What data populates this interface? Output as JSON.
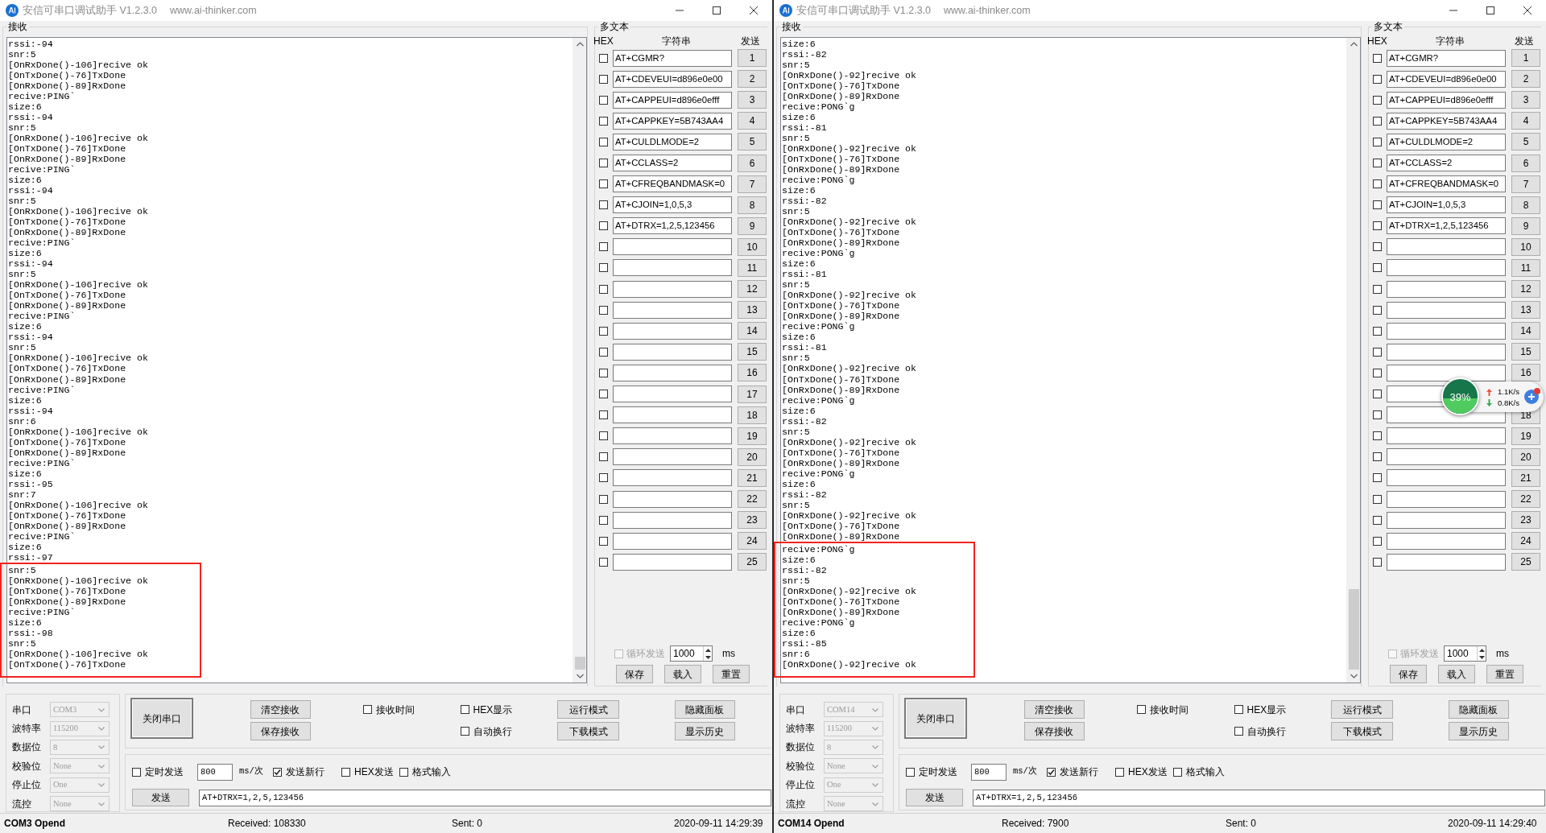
{
  "windows": [
    {
      "title": "安信可串口调试助手 V1.2.3.0",
      "website": "www.ai-thinker.com",
      "receive": {
        "label": "接收",
        "lines": [
          "rssi:-94",
          "snr:5",
          "[OnRxDone()-106]recive ok",
          "[OnTxDone()-76]TxDone",
          "[OnRxDone()-89]RxDone",
          "recive:PING`",
          "size:6",
          "rssi:-94",
          "snr:5",
          "[OnRxDone()-106]recive ok",
          "[OnTxDone()-76]TxDone",
          "[OnRxDone()-89]RxDone",
          "recive:PING`",
          "size:6",
          "rssi:-94",
          "snr:5",
          "[OnRxDone()-106]recive ok",
          "[OnTxDone()-76]TxDone",
          "[OnRxDone()-89]RxDone",
          "recive:PING`",
          "size:6",
          "rssi:-94",
          "snr:5",
          "[OnRxDone()-106]recive ok",
          "[OnTxDone()-76]TxDone",
          "[OnRxDone()-89]RxDone",
          "recive:PING`",
          "size:6",
          "rssi:-94",
          "snr:5",
          "[OnRxDone()-106]recive ok",
          "[OnTxDone()-76]TxDone",
          "[OnRxDone()-89]RxDone",
          "recive:PING`",
          "size:6",
          "rssi:-94",
          "snr:6",
          "[OnRxDone()-106]recive ok",
          "[OnTxDone()-76]TxDone",
          "[OnRxDone()-89]RxDone",
          "recive:PING`",
          "size:6",
          "rssi:-95",
          "snr:7",
          "[OnRxDone()-106]recive ok",
          "[OnTxDone()-76]TxDone",
          "[OnRxDone()-89]RxDone",
          "recive:PING`",
          "size:6",
          "rssi:-97"
        ],
        "highlighted_lines": [
          "snr:5",
          "[OnRxDone()-106]recive ok",
          "[OnTxDone()-76]TxDone",
          "[OnRxDone()-89]RxDone",
          "recive:PING`",
          "size:6",
          "rssi:-98",
          "snr:5",
          "[OnRxDone()-106]recive ok",
          "[OnTxDone()-76]TxDone"
        ]
      },
      "multi_text": {
        "label": "多文本",
        "columns": [
          "HEX",
          "字符串",
          "发送"
        ],
        "rows": [
          {
            "hex": false,
            "text": "AT+CGMR?",
            "button": "1"
          },
          {
            "hex": false,
            "text": "AT+CDEVEUI=d896e0e00",
            "button": "2"
          },
          {
            "hex": false,
            "text": "AT+CAPPEUI=d896e0efff",
            "button": "3"
          },
          {
            "hex": false,
            "text": "AT+CAPPKEY=5B743AA4",
            "button": "4"
          },
          {
            "hex": false,
            "text": "AT+CULDLMODE=2",
            "button": "5"
          },
          {
            "hex": false,
            "text": "AT+CCLASS=2",
            "button": "6"
          },
          {
            "hex": false,
            "text": "AT+CFREQBANDMASK=0",
            "button": "7"
          },
          {
            "hex": false,
            "text": "AT+CJOIN=1,0,5,3",
            "button": "8"
          },
          {
            "hex": false,
            "text": "AT+DTRX=1,2,5,123456",
            "button": "9"
          },
          {
            "hex": false,
            "button": "10"
          },
          {
            "hex": false,
            "button": "11"
          },
          {
            "hex": false,
            "button": "12"
          },
          {
            "hex": false,
            "button": "13"
          },
          {
            "hex": false,
            "button": "14"
          },
          {
            "hex": false,
            "button": "15"
          },
          {
            "hex": false,
            "button": "16"
          },
          {
            "hex": false,
            "button": "17"
          },
          {
            "hex": false,
            "button": "18"
          },
          {
            "hex": false,
            "button": "19"
          },
          {
            "hex": false,
            "button": "20"
          },
          {
            "hex": false,
            "button": "21"
          },
          {
            "hex": false,
            "button": "22"
          },
          {
            "hex": false,
            "button": "23"
          },
          {
            "hex": false,
            "button": "24"
          },
          {
            "hex": false,
            "button": "25"
          }
        ],
        "loop_send": {
          "label": "循环发送",
          "checked": false,
          "disabled": true,
          "interval": "1000",
          "unit": "ms"
        },
        "buttons": [
          "保存",
          "载入",
          "重置"
        ]
      },
      "serial_settings": [
        {
          "label": "串口",
          "value": "COM3",
          "disabled": true
        },
        {
          "label": "波特率",
          "value": "115200",
          "disabled": true
        },
        {
          "label": "数据位",
          "value": "8",
          "disabled": true
        },
        {
          "label": "校验位",
          "value": "None",
          "disabled": true
        },
        {
          "label": "停止位",
          "value": "One",
          "disabled": true
        },
        {
          "label": "流控",
          "value": "None",
          "disabled": true
        }
      ],
      "port_button": "关闭串口",
      "receive_buttons": [
        "清空接收",
        "保存接收"
      ],
      "options": [
        {
          "label": "接收时间",
          "checked": false
        },
        {
          "label": "HEX显示",
          "checked": false
        },
        {
          "label": "自动换行",
          "checked": false
        }
      ],
      "mode_buttons": [
        "运行模式",
        "下载模式"
      ],
      "panel_buttons": [
        "隐藏面板",
        "显示历史"
      ],
      "send": {
        "timed": {
          "label": "定时发送",
          "checked": false
        },
        "interval": "800",
        "unit": "ms/次",
        "options": [
          {
            "label": "发送新行",
            "checked": true
          },
          {
            "label": "HEX发送",
            "checked": false
          },
          {
            "label": "格式输入",
            "checked": false
          }
        ],
        "button": "发送",
        "text": "AT+DTRX=1,2,5,123456"
      },
      "status": {
        "port": "COM3 Opend",
        "received": "Received: 108330",
        "sent": "Sent: 0",
        "time": "2020-09-11 14:29:39"
      }
    },
    {
      "title": "安信可串口调试助手 V1.2.3.0",
      "website": "www.ai-thinker.com",
      "receive": {
        "label": "接收",
        "lines": [
          "size:6",
          "rssi:-82",
          "snr:5",
          "[OnRxDone()-92]recive ok",
          "[OnTxDone()-76]TxDone",
          "[OnRxDone()-89]RxDone",
          "recive:PONG`g",
          "size:6",
          "rssi:-81",
          "snr:5",
          "[OnRxDone()-92]recive ok",
          "[OnTxDone()-76]TxDone",
          "[OnRxDone()-89]RxDone",
          "recive:PONG`g",
          "size:6",
          "rssi:-82",
          "snr:5",
          "[OnRxDone()-92]recive ok",
          "[OnTxDone()-76]TxDone",
          "[OnRxDone()-89]RxDone",
          "recive:PONG`g",
          "size:6",
          "rssi:-81",
          "snr:5",
          "[OnRxDone()-92]recive ok",
          "[OnTxDone()-76]TxDone",
          "[OnRxDone()-89]RxDone",
          "recive:PONG`g",
          "size:6",
          "rssi:-81",
          "snr:5",
          "[OnRxDone()-92]recive ok",
          "[OnTxDone()-76]TxDone",
          "[OnRxDone()-89]RxDone",
          "recive:PONG`g",
          "size:6",
          "rssi:-82",
          "snr:5",
          "[OnRxDone()-92]recive ok",
          "[OnTxDone()-76]TxDone",
          "[OnRxDone()-89]RxDone",
          "recive:PONG`g",
          "size:6",
          "rssi:-82",
          "snr:5",
          "[OnRxDone()-92]recive ok",
          "[OnTxDone()-76]TxDone",
          "[OnRxDone()-89]RxDone"
        ],
        "highlighted_lines": [
          "recive:PONG`g",
          "size:6",
          "rssi:-82",
          "snr:5",
          "[OnRxDone()-92]recive ok",
          "[OnTxDone()-76]TxDone",
          "[OnRxDone()-89]RxDone",
          "recive:PONG`g",
          "size:6",
          "rssi:-85",
          "snr:6",
          "[OnRxDone()-92]recive ok"
        ]
      },
      "multi_text": {
        "label": "多文本",
        "columns": [
          "HEX",
          "字符串",
          "发送"
        ],
        "rows": [
          {
            "hex": false,
            "text": "AT+CGMR?",
            "button": "1"
          },
          {
            "hex": false,
            "text": "AT+CDEVEUI=d896e0e00",
            "button": "2"
          },
          {
            "hex": false,
            "text": "AT+CAPPEUI=d896e0efff",
            "button": "3"
          },
          {
            "hex": false,
            "text": "AT+CAPPKEY=5B743AA4",
            "button": "4"
          },
          {
            "hex": false,
            "text": "AT+CULDLMODE=2",
            "button": "5"
          },
          {
            "hex": false,
            "text": "AT+CCLASS=2",
            "button": "6"
          },
          {
            "hex": false,
            "text": "AT+CFREQBANDMASK=0",
            "button": "7"
          },
          {
            "hex": false,
            "text": "AT+CJOIN=1,0,5,3",
            "button": "8"
          },
          {
            "hex": false,
            "text": "AT+DTRX=1,2,5,123456",
            "button": "9"
          },
          {
            "hex": false,
            "button": "10"
          },
          {
            "hex": false,
            "button": "11"
          },
          {
            "hex": false,
            "button": "12"
          },
          {
            "hex": false,
            "button": "13"
          },
          {
            "hex": false,
            "button": "14"
          },
          {
            "hex": false,
            "button": "15"
          },
          {
            "hex": false,
            "button": "16"
          },
          {
            "hex": false
          },
          {
            "hex": false,
            "button": "18"
          },
          {
            "hex": false,
            "button": "19"
          },
          {
            "hex": false,
            "button": "20"
          },
          {
            "hex": false,
            "button": "21"
          },
          {
            "hex": false,
            "button": "22"
          },
          {
            "hex": false,
            "button": "23"
          },
          {
            "hex": false,
            "button": "24"
          },
          {
            "hex": false,
            "button": "25"
          }
        ],
        "loop_send": {
          "label": "循环发送",
          "checked": false,
          "disabled": true,
          "interval": "1000",
          "unit": "ms"
        },
        "buttons": [
          "保存",
          "载入",
          "重置"
        ]
      },
      "serial_settings": [
        {
          "label": "串口",
          "value": "COM14",
          "disabled": true
        },
        {
          "label": "波特率",
          "value": "115200",
          "disabled": true
        },
        {
          "label": "数据位",
          "value": "8",
          "disabled": true
        },
        {
          "label": "校验位",
          "value": "None",
          "disabled": true
        },
        {
          "label": "停止位",
          "value": "One",
          "disabled": true
        },
        {
          "label": "流控",
          "value": "None",
          "disabled": true
        }
      ],
      "port_button": "关闭串口",
      "receive_buttons": [
        "清空接收",
        "保存接收"
      ],
      "options": [
        {
          "label": "接收时间",
          "checked": false
        },
        {
          "label": "HEX显示",
          "checked": false
        },
        {
          "label": "自动换行",
          "checked": false
        }
      ],
      "mode_buttons": [
        "运行模式",
        "下载模式"
      ],
      "panel_buttons": [
        "隐藏面板",
        "显示历史"
      ],
      "send": {
        "timed": {
          "label": "定时发送",
          "checked": false
        },
        "interval": "800",
        "unit": "ms/次",
        "options": [
          {
            "label": "发送新行",
            "checked": true
          },
          {
            "label": "HEX发送",
            "checked": false
          },
          {
            "label": "格式输入",
            "checked": false
          }
        ],
        "button": "发送",
        "text": "AT+DTRX=1,2,5,123456"
      },
      "status": {
        "port": "COM14 Opend",
        "received": "Received: 7900",
        "sent": "Sent: 0",
        "time": "2020-09-11 14:29:40"
      },
      "net_monitor": {
        "percent": "39%",
        "upload": "1.1K/s",
        "download": "0.8K/s"
      }
    }
  ]
}
